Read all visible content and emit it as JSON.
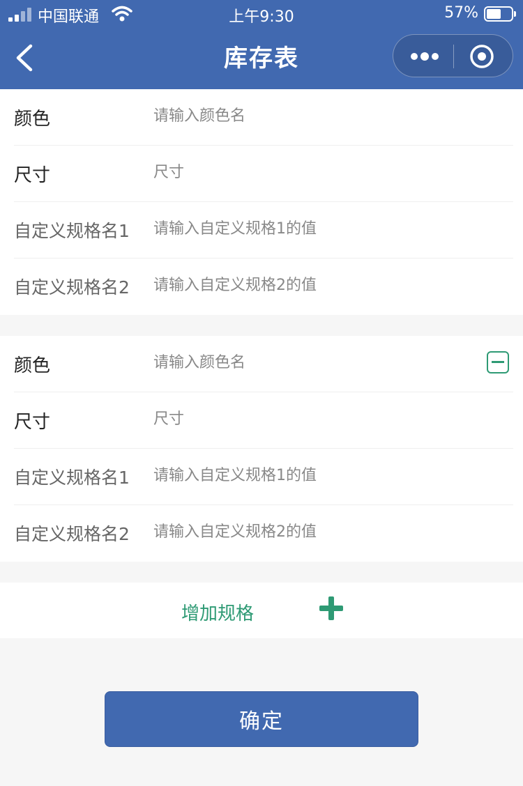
{
  "status_bar": {
    "carrier": "中国联通",
    "time": "上午9:30",
    "battery": "57%"
  },
  "nav": {
    "title": "库存表"
  },
  "specs": [
    {
      "color_label": "颜色",
      "color_placeholder": "请输入颜色名",
      "size_label": "尺寸",
      "size_placeholder": "尺寸",
      "custom1_label": "自定义规格名1",
      "custom1_placeholder": "请输入自定义规格1的值",
      "custom2_label": "自定义规格名2",
      "custom2_placeholder": "请输入自定义规格2的值"
    },
    {
      "color_label": "颜色",
      "color_placeholder": "请输入颜色名",
      "size_label": "尺寸",
      "size_placeholder": "尺寸",
      "custom1_label": "自定义规格名1",
      "custom1_placeholder": "请输入自定义规格1的值",
      "custom2_label": "自定义规格名2",
      "custom2_placeholder": "请输入自定义规格2的值"
    }
  ],
  "add_spec_label": "增加规格",
  "confirm_label": "确定",
  "colors": {
    "primary": "#4169b0",
    "accent": "#2e9a74"
  }
}
